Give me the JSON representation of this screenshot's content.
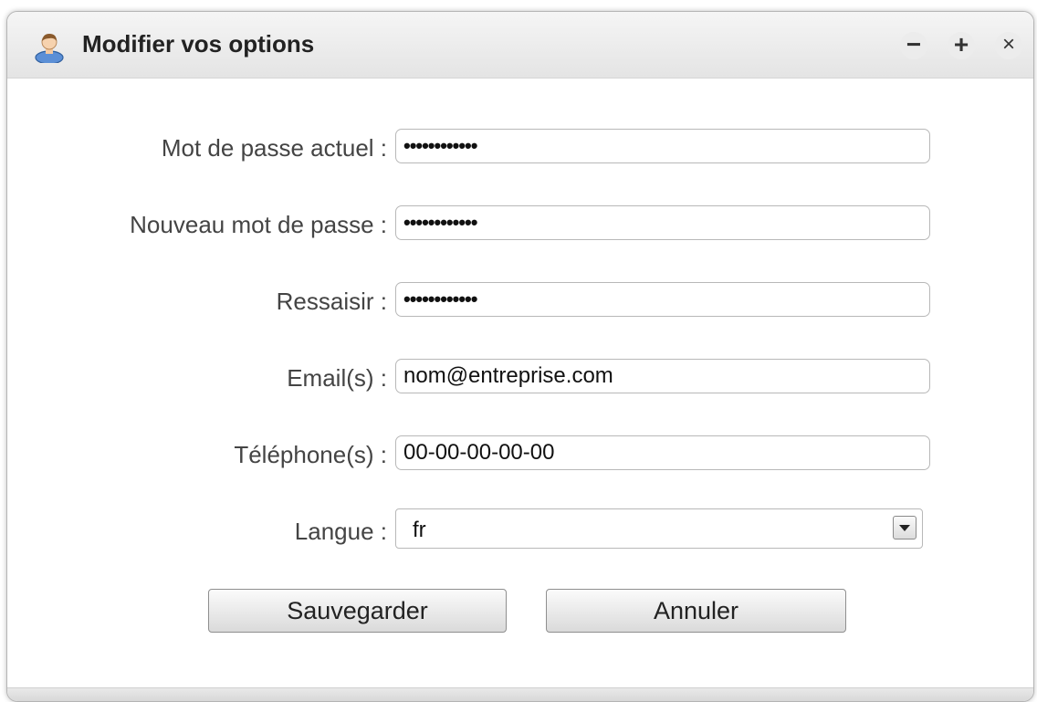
{
  "window": {
    "title": "Modifier vos options",
    "controls": {
      "minimize": "−",
      "maximize": "+",
      "close": "×"
    },
    "icon": "user-icon"
  },
  "form": {
    "current_password": {
      "label": "Mot de passe actuel :",
      "value": "••••••••••••"
    },
    "new_password": {
      "label": "Nouveau mot de passe :",
      "value": "••••••••••••"
    },
    "confirm_password": {
      "label": "Ressaisir :",
      "value": "••••••••••••"
    },
    "email": {
      "label": "Email(s) :",
      "value": "nom@entreprise.com"
    },
    "phone": {
      "label": "Téléphone(s) :",
      "value": "00-00-00-00-00"
    },
    "language": {
      "label": "Langue :",
      "selected": "fr"
    }
  },
  "buttons": {
    "save": "Sauvegarder",
    "cancel": "Annuler"
  }
}
